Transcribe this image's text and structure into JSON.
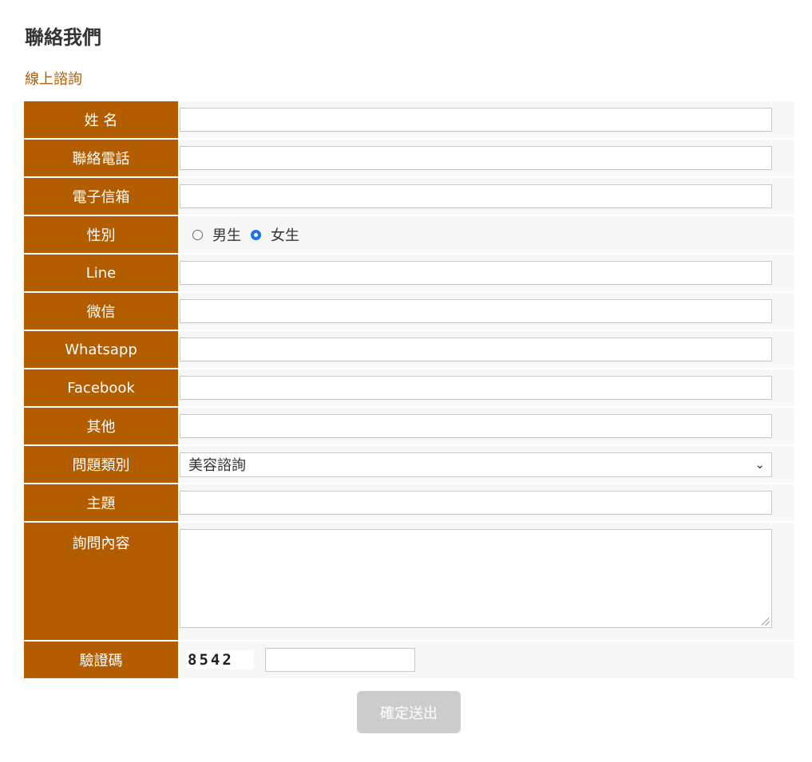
{
  "page": {
    "title": "聯絡我們",
    "subtitle": "線上諮詢"
  },
  "form": {
    "labels": {
      "name": "姓 名",
      "phone": "聯絡電話",
      "email": "電子信箱",
      "gender": "性別",
      "line": "Line",
      "wechat": "微信",
      "whatsapp": "Whatsapp",
      "facebook": "Facebook",
      "other": "其他",
      "category": "問題類別",
      "subject": "主題",
      "content": "詢問內容",
      "captcha": "驗證碼"
    },
    "values": {
      "name": "",
      "phone": "",
      "email": "",
      "line": "",
      "wechat": "",
      "whatsapp": "",
      "facebook": "",
      "other": "",
      "subject": "",
      "content": "",
      "captcha_input": ""
    },
    "gender_options": {
      "male": "男生",
      "female": "女生",
      "selected": "female"
    },
    "category_selected": "美容諮詢",
    "captcha_code": "8542",
    "submit_label": "確定送出"
  }
}
